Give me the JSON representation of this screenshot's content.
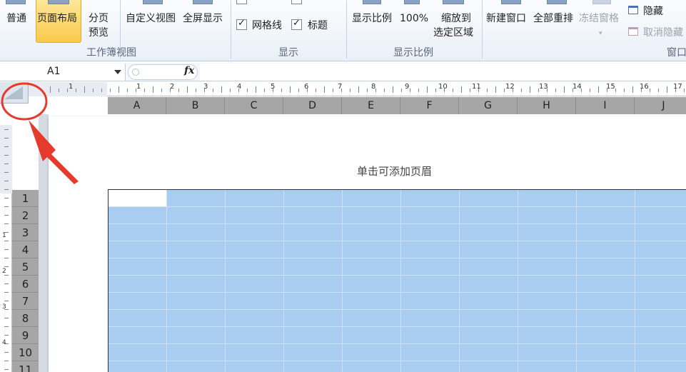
{
  "ribbon": {
    "buttons": {
      "normal": "普通",
      "page_layout": "页面布局",
      "page_break_1": "分页",
      "page_break_2": "预览",
      "custom_views": "自定义视图",
      "full_screen": "全屏显示",
      "zoom": "显示比例",
      "zoom_100": "100%",
      "zoom_sel_1": "缩放到",
      "zoom_sel_2": "选定区域",
      "new_window": "新建窗口",
      "arrange_all": "全部重排",
      "freeze_panes": "冻结窗格",
      "hide": "隐藏",
      "unhide": "取消隐藏"
    },
    "checkboxes": {
      "gridlines": "网格线",
      "headings": "标题",
      "gridlines_checked": true,
      "headings_checked": true
    },
    "groups": {
      "workbook_views": "工作簿视图",
      "show": "显示",
      "zoom": "显示比例",
      "window": "窗口"
    }
  },
  "formula_bar": {
    "name_box": "A1",
    "fx": "fx",
    "formula": ""
  },
  "sheet": {
    "columns": [
      "A",
      "B",
      "C",
      "D",
      "E",
      "F",
      "G",
      "H",
      "I",
      "J"
    ],
    "rows": [
      "1",
      "2",
      "3",
      "4",
      "5",
      "6",
      "7",
      "8",
      "9",
      "10",
      "11"
    ],
    "header_placeholder": "单击可添加页眉",
    "selection_color": "#a9cdf0"
  },
  "ruler": {
    "h_numbers": [
      "1",
      "1",
      "2",
      "3",
      "4",
      "5",
      "6",
      "7",
      "8",
      "9",
      "10",
      "11",
      "12",
      "13",
      "14",
      "15",
      "16",
      "17"
    ],
    "v_numbers": [
      "1",
      "2",
      "3",
      "4"
    ]
  },
  "annotation": {
    "color": "#e53b2c"
  }
}
